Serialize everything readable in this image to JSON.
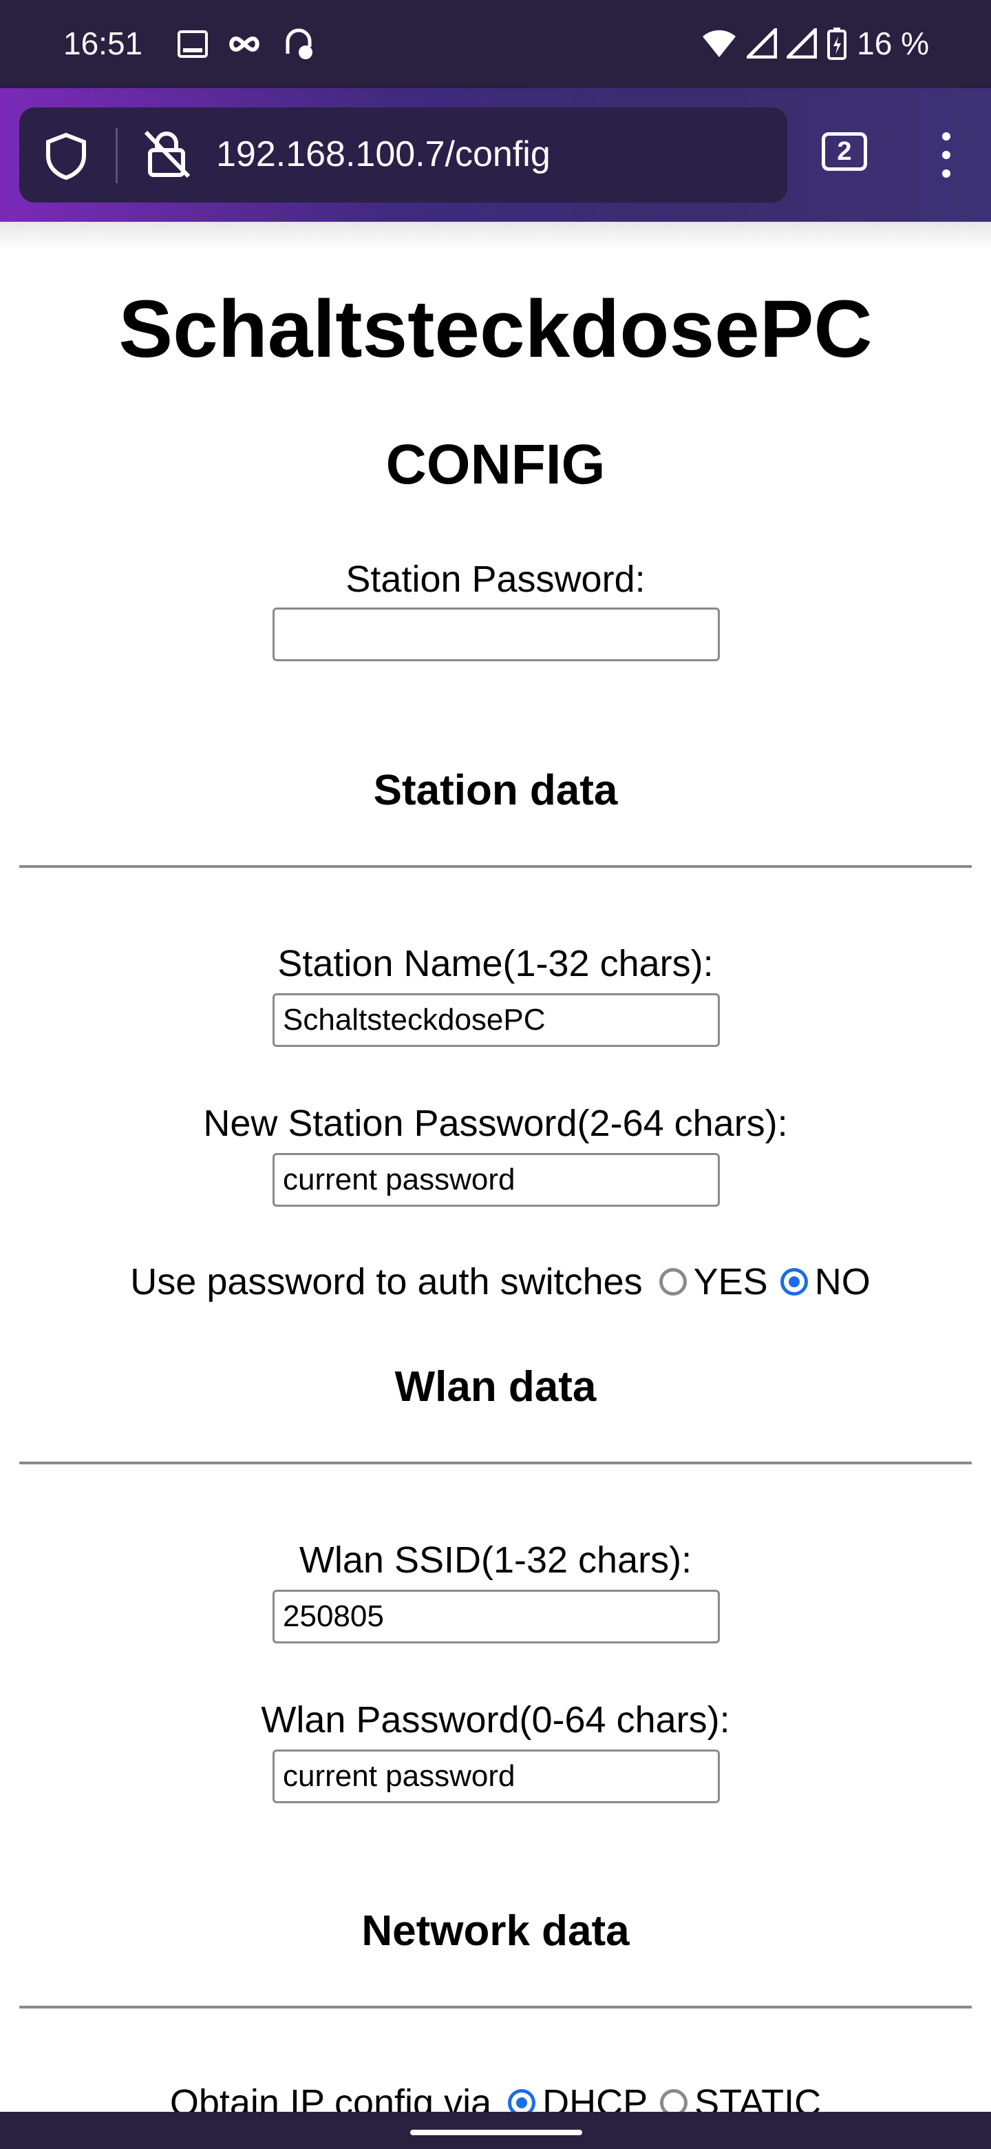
{
  "status_bar": {
    "time": "16:51",
    "battery": "16 %",
    "icons": [
      "gallery-icon",
      "infinity-icon",
      "sync-icon",
      "wifi-icon",
      "signal-icon",
      "signal-icon",
      "battery-icon"
    ]
  },
  "browser": {
    "url": "192.168.100.7/config",
    "tab_count": "2"
  },
  "page": {
    "title": "SchaltsteckdosePC",
    "subtitle": "CONFIG",
    "station_password_label": "Station Password:",
    "station_password_value": "",
    "sections": {
      "station": "Station data",
      "wlan": "Wlan data",
      "network": "Network data"
    },
    "station_name_label": "Station Name(1-32 chars):",
    "station_name_value": "SchaltsteckdosePC",
    "new_password_label": "New Station Password(2-64 chars):",
    "new_password_value": "current password",
    "auth_label": "Use password to auth switches",
    "auth_yes": "YES",
    "auth_no": "NO",
    "auth_selected": "NO",
    "ssid_label": "Wlan SSID(1-32 chars):",
    "ssid_value": "250805",
    "wlan_password_label": "Wlan Password(0-64 chars):",
    "wlan_password_value": "current password",
    "ip_label": "Obtain IP config via",
    "ip_dhcp": "DHCP",
    "ip_static": "STATIC",
    "ip_selected": "DHCP"
  },
  "colors": {
    "status_bar_bg": "#29213f",
    "radio_accent": "#1a6ee6"
  }
}
